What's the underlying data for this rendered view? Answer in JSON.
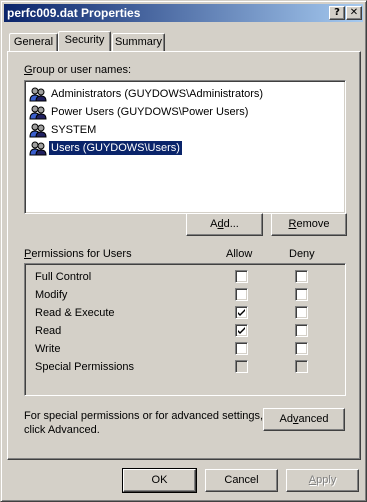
{
  "window": {
    "title": "perfc009.dat Properties",
    "help_btn": "?",
    "close_btn": "✕"
  },
  "tabs": [
    {
      "label": "General",
      "active": false
    },
    {
      "label": "Security",
      "active": true
    },
    {
      "label": "Summary",
      "active": false
    }
  ],
  "group_label": {
    "pre": "",
    "key": "G",
    "post": "roup or user names:"
  },
  "users": [
    {
      "label": "Administrators (GUYDOWS\\Administrators)",
      "selected": false
    },
    {
      "label": "Power Users (GUYDOWS\\Power Users)",
      "selected": false
    },
    {
      "label": "SYSTEM",
      "selected": false
    },
    {
      "label": "Users (GUYDOWS\\Users)",
      "selected": true
    }
  ],
  "add_btn": {
    "pre": "A",
    "key": "d",
    "post": "d..."
  },
  "remove_btn": {
    "pre": "",
    "key": "R",
    "post": "emove"
  },
  "permissions": {
    "label": {
      "pre": "",
      "key": "P",
      "post": "ermissions for Users"
    },
    "allow_header": "Allow",
    "deny_header": "Deny",
    "rows": [
      {
        "name": "Full Control",
        "allow": false,
        "deny": false,
        "disabled": false
      },
      {
        "name": "Modify",
        "allow": false,
        "deny": false,
        "disabled": false
      },
      {
        "name": "Read & Execute",
        "allow": true,
        "deny": false,
        "disabled": false
      },
      {
        "name": "Read",
        "allow": true,
        "deny": false,
        "disabled": false
      },
      {
        "name": "Write",
        "allow": false,
        "deny": false,
        "disabled": false
      },
      {
        "name": "Special Permissions",
        "allow": false,
        "deny": false,
        "disabled": true
      }
    ]
  },
  "advanced_note_1": "For special permissions or for advanced settings,",
  "advanced_note_2": "click Advanced.",
  "advanced_btn": {
    "pre": "Ad",
    "key": "v",
    "post": "anced"
  },
  "footer": {
    "ok": "OK",
    "cancel": "Cancel",
    "apply": {
      "pre": "",
      "key": "A",
      "post": "pply"
    }
  },
  "colors": {
    "selection": "#0a246a",
    "face": "#d4d0c8"
  }
}
